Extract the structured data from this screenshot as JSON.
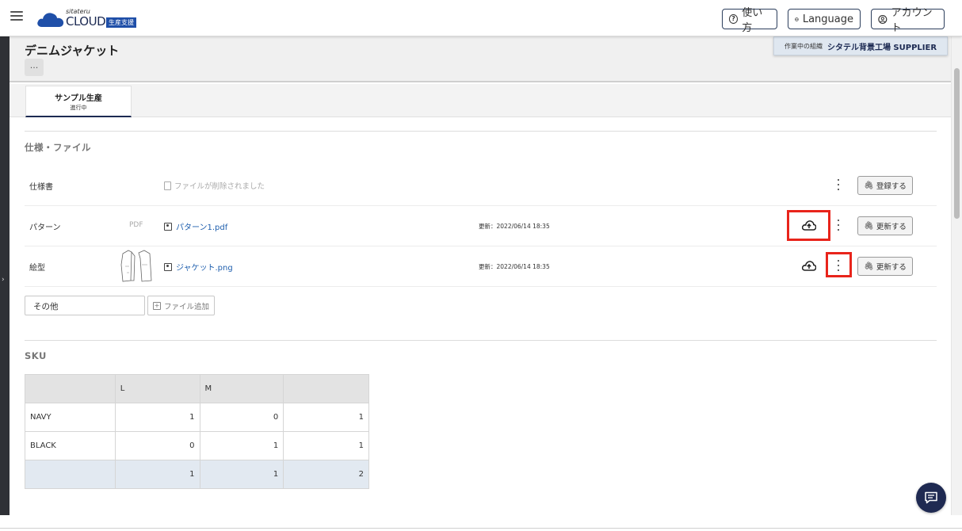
{
  "header": {
    "logo_small": "sitateru",
    "logo_main": "CLOUD",
    "logo_badge": "生産支援",
    "help_label": "使い方",
    "language_label": "Language",
    "account_label": "アカウント"
  },
  "page": {
    "title": "デニムジャケット",
    "more_label": "···"
  },
  "org": {
    "label": "作業中の組織",
    "name": "シタテル背景工場 SUPPLIER"
  },
  "tabs": [
    {
      "label": "サンプル生産",
      "status": "進行中"
    }
  ],
  "spec_section": {
    "title": "仕様・ファイル",
    "rows": [
      {
        "label": "仕様書",
        "file_text": "ファイルが削除されました",
        "button": "登録する"
      },
      {
        "label": "パターン",
        "type": "PDF",
        "file_name": "パターン1.pdf",
        "updated": "更新：2022/06/14 18:35",
        "button": "更新する"
      },
      {
        "label": "絵型",
        "file_name": "ジャケット.png",
        "updated": "更新：2022/06/14 18:35",
        "button": "更新する"
      }
    ],
    "other_value": "その他",
    "add_file_label": "ファイル追加"
  },
  "sku_section": {
    "title": "SKU",
    "columns": [
      "",
      "L",
      "M",
      ""
    ],
    "rows": [
      {
        "name": "NAVY",
        "values": [
          "1",
          "0",
          "1"
        ]
      },
      {
        "name": "BLACK",
        "values": [
          "0",
          "1",
          "1"
        ]
      }
    ],
    "totals": [
      "1",
      "1",
      "2"
    ]
  },
  "colors": {
    "brand_navy": "#1c2a52",
    "link_blue": "#1f5fae",
    "highlight_red": "#e8241b"
  },
  "icons": {
    "menu": "hamburger-icon",
    "help": "question-circle-icon",
    "language": "globe-icon",
    "account": "user-circle-icon",
    "upload": "cloud-upload-icon",
    "more": "kebab-vertical-icon",
    "attach": "paperclip-icon",
    "chat": "chat-icon"
  }
}
